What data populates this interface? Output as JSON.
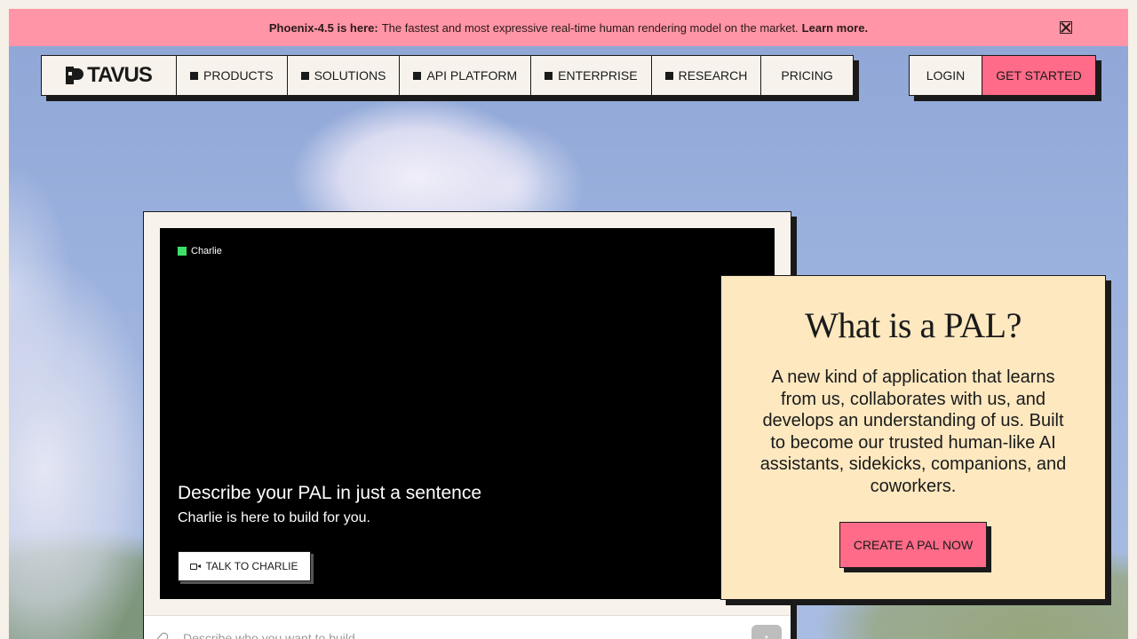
{
  "banner": {
    "strong": "Phoenix-4.5 is here:",
    "text": "The fastest and most expressive real-time human rendering model on the market.",
    "link": "Learn more."
  },
  "nav": {
    "logo": "TAVUS",
    "items": [
      {
        "label": "PRODUCTS"
      },
      {
        "label": "SOLUTIONS"
      },
      {
        "label": "API PLATFORM"
      },
      {
        "label": "ENTERPRISE"
      },
      {
        "label": "RESEARCH"
      },
      {
        "label": "PRICING"
      }
    ],
    "login": "LOGIN",
    "get_started": "GET STARTED"
  },
  "video": {
    "speaker": "Charlie",
    "headline": "Describe your PAL in just a sentence",
    "subtitle": "Charlie is here to build for you.",
    "talk_button": "TALK TO CHARLIE"
  },
  "prompt": {
    "placeholder": "Describe who you want to build"
  },
  "pal": {
    "title": "What is a PAL?",
    "description": "A new kind of application that learns from us, collaborates with us, and develops an understanding of us. Built to become our trusted human-like AI assistants, sidekicks, companions, and coworkers.",
    "button": "CREATE A PAL NOW"
  },
  "colors": {
    "banner": "#ff95a6",
    "accent": "#ff6b88",
    "panel": "#fde8c0",
    "live_dot": "#3ee06a"
  },
  "icons": [
    "close-icon",
    "logo-mark-icon",
    "square-bullet-icon",
    "camera-icon",
    "paperclip-icon",
    "arrow-up-icon"
  ]
}
